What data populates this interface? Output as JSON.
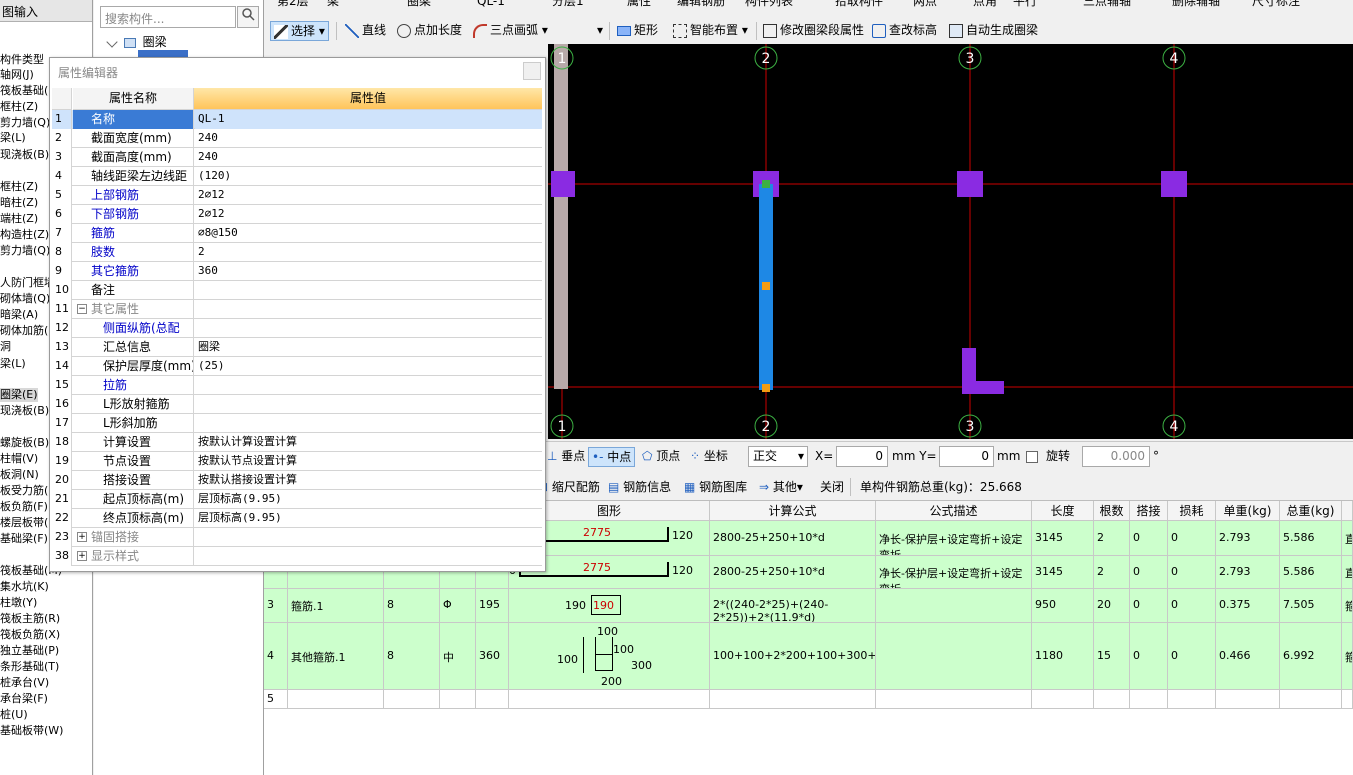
{
  "left_nav": {
    "header": "图输入",
    "items": [
      "构件类型",
      "轴网(J)",
      "筏板基础(",
      "框柱(Z)",
      "剪力墙(Q)",
      "梁(L)",
      "现浇板(B)",
      "框柱(Z)",
      "暗柱(Z)",
      "端柱(Z)",
      "构造柱(Z)",
      "剪力墙(Q)",
      "人防门框墙",
      "砌体墙(Q)",
      "暗梁(A)",
      "砌体加筋(",
      "洞",
      "梁(L)",
      "圈梁(E)",
      "现浇板(B)",
      "螺旋板(B)",
      "柱帽(V)",
      "板洞(N)",
      "板受力筋(S",
      "板负筋(F)",
      "楼层板带(",
      "基础梁(F)",
      "筏板基础(M)",
      "集水坑(K)",
      "柱墩(Y)",
      "筏板主筋(R)",
      "筏板负筋(X)",
      "独立基础(P)",
      "条形基础(T)",
      "桩承台(V)",
      "承台梁(F)",
      "桩(U)",
      "基础板带(W)"
    ],
    "selected_index": 18
  },
  "tree": {
    "search_placeholder": "搜索构件...",
    "root_label": "圈梁"
  },
  "toolbar1": {
    "items": [
      "第2层",
      "梁",
      "圈梁",
      "QL-1",
      "分层1",
      "属性",
      "编辑钢筋",
      "构件列表",
      "拾取构件",
      "两点",
      "点角",
      "平行",
      "三点辅轴",
      "删除辅轴",
      "尺寸标注"
    ]
  },
  "toolbar2": {
    "items": [
      "选择",
      "直线",
      "点加长度",
      "三点画弧",
      "矩形",
      "智能布置",
      "修改圈梁段属性",
      "查改标高",
      "自动生成圈梁"
    ]
  },
  "canvas": {
    "axis_labels_top": [
      "1",
      "2",
      "3",
      "4"
    ],
    "axis_labels_bottom": [
      "1",
      "2",
      "3",
      "4"
    ]
  },
  "snapbar": {
    "items": [
      "垂点",
      "中点",
      "顶点",
      "坐标"
    ],
    "mode": "正交",
    "x_label": "X=",
    "x_value": "0",
    "y_label": "mm Y=",
    "y_value": "0",
    "unit": "mm",
    "rotate_label": "旋转",
    "rotate_value": "0.000",
    "degree": "°"
  },
  "rebarbar": {
    "items": [
      "缩尺配筋",
      "钢筋信息",
      "钢筋图库",
      "其他",
      "关闭"
    ],
    "total_label": "单构件钢筋总重(kg)：25.668"
  },
  "grid": {
    "headers": [
      "图形",
      "计算公式",
      "公式描述",
      "长度(mm)",
      "根数",
      "搭接",
      "损耗(%)",
      "单重(kg)",
      "总重(kg)"
    ],
    "rows": [
      {
        "num": "",
        "name": "",
        "dia": "",
        "grade": "",
        "shape_left": "0",
        "shape_mid": "2775",
        "shape_right": "120",
        "formula": "2800-25+250+10*d",
        "desc": "净长-保护层+设定弯折+设定弯折",
        "length": "3145",
        "count": "2",
        "lap": "0",
        "loss": "0",
        "unit_w": "2.793",
        "total_w": "5.586",
        "extra": "直"
      },
      {
        "num": "",
        "name": "",
        "dia": "",
        "grade": "",
        "shape_left": "0",
        "shape_mid": "2775",
        "shape_right": "120",
        "formula": "2800-25+250+10*d",
        "desc": "净长-保护层+设定弯折+设定弯折",
        "length": "3145",
        "count": "2",
        "lap": "0",
        "loss": "0",
        "unit_w": "2.793",
        "total_w": "5.586",
        "extra": "直"
      },
      {
        "num": "3",
        "name": "箍筋.1",
        "dia": "8",
        "grade": "Φ",
        "code": "195",
        "shape_left": "190",
        "shape_mid": "190",
        "formula": "2*((240-2*25)+(240-2*25))+2*(11.9*d)",
        "desc": "",
        "length": "950",
        "count": "20",
        "lap": "0",
        "loss": "0",
        "unit_w": "0.375",
        "total_w": "7.505",
        "extra": "箍"
      },
      {
        "num": "4",
        "name": "其他箍筋.1",
        "dia": "8",
        "grade": "中",
        "code": "360",
        "shape_top": "100",
        "shape_right": "100",
        "shape_r2": "300",
        "shape_left": "100",
        "shape_bottom": "200",
        "formula": "100+100+2*200+100+300+12*d+10.5*d",
        "desc": "",
        "length": "1180",
        "count": "15",
        "lap": "0",
        "loss": "0",
        "unit_w": "0.466",
        "total_w": "6.992",
        "extra": "箍"
      },
      {
        "num": "5"
      }
    ]
  },
  "prop_dialog": {
    "title": "属性编辑器",
    "col_name": "属性名称",
    "col_value": "属性值",
    "rows": [
      {
        "n": "1",
        "name": "名称",
        "value": "QL-1"
      },
      {
        "n": "2",
        "name": "截面宽度(mm)",
        "value": "240"
      },
      {
        "n": "3",
        "name": "截面高度(mm)",
        "value": "240"
      },
      {
        "n": "4",
        "name": "轴线距梁左边线距",
        "value": "(120)"
      },
      {
        "n": "5",
        "name": "上部钢筋",
        "value": "2⌀12"
      },
      {
        "n": "6",
        "name": "下部钢筋",
        "value": "2⌀12"
      },
      {
        "n": "7",
        "name": "箍筋",
        "value": "⌀8@150"
      },
      {
        "n": "8",
        "name": "肢数",
        "value": "2"
      },
      {
        "n": "9",
        "name": "其它箍筋",
        "value": "360"
      },
      {
        "n": "10",
        "name": "备注",
        "value": ""
      },
      {
        "n": "11",
        "name": "其它属性",
        "value": ""
      },
      {
        "n": "12",
        "name": "侧面纵筋(总配",
        "value": ""
      },
      {
        "n": "13",
        "name": "汇总信息",
        "value": "圈梁"
      },
      {
        "n": "14",
        "name": "保护层厚度(mm)",
        "value": "(25)"
      },
      {
        "n": "15",
        "name": "拉筋",
        "value": ""
      },
      {
        "n": "16",
        "name": "L形放射箍筋",
        "value": ""
      },
      {
        "n": "17",
        "name": "L形斜加筋",
        "value": ""
      },
      {
        "n": "18",
        "name": "计算设置",
        "value": "按默认计算设置计算"
      },
      {
        "n": "19",
        "name": "节点设置",
        "value": "按默认节点设置计算"
      },
      {
        "n": "20",
        "name": "搭接设置",
        "value": "按默认搭接设置计算"
      },
      {
        "n": "21",
        "name": "起点顶标高(m)",
        "value": "层顶标高(9.95)"
      },
      {
        "n": "22",
        "name": "终点顶标高(m)",
        "value": "层顶标高(9.95)"
      },
      {
        "n": "23",
        "name": "锚固搭接",
        "value": ""
      },
      {
        "n": "38",
        "name": "显示样式",
        "value": ""
      }
    ]
  },
  "colors": {
    "accent": "#ffcc66",
    "grid_row": "#ccffcc",
    "canvas_bg": "#000000",
    "axis_line": "#cc0000",
    "beam": "#1e88e5",
    "column": "#8a2be2",
    "axis_circle": "#3cb043"
  }
}
